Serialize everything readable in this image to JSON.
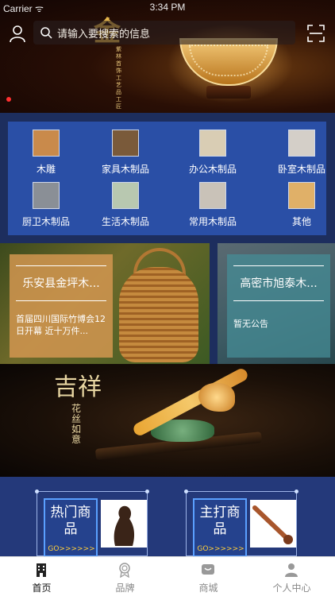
{
  "status": {
    "carrier": "Carrier ᯤ",
    "time": "3:34 PM"
  },
  "search": {
    "placeholder": "请输入要搜索的信息"
  },
  "banner": {
    "calligraphy": "金",
    "vertical": "紫林首饰工艺品工匠"
  },
  "categories": [
    {
      "label": "木雕",
      "thumb": "#c98a4b"
    },
    {
      "label": "家具木制品",
      "thumb": "#7a5a3a"
    },
    {
      "label": "办公木制品",
      "thumb": "#d9cdb4"
    },
    {
      "label": "卧室木制品",
      "thumb": "#d4cfc8"
    },
    {
      "label": "厨卫木制品",
      "thumb": "#8a8f96"
    },
    {
      "label": "生活木制品",
      "thumb": "#b8c8b0"
    },
    {
      "label": "常用木制品",
      "thumb": "#c9c2b8"
    },
    {
      "label": "其他",
      "thumb": "#e0b068"
    }
  ],
  "promos": {
    "left": {
      "title": "乐安县金坪木...",
      "desc": "首届四川国际竹博会12日开幕 近十万件..."
    },
    "right": {
      "title": "高密市旭泰木...",
      "desc": "暂无公告"
    }
  },
  "banner2": {
    "calligraphy": "吉祥",
    "sub": "花丝如意"
  },
  "featured": [
    {
      "title": "热门商品",
      "go": "GO>>>>>>"
    },
    {
      "title": "主打商品",
      "go": "GO>>>>>>"
    }
  ],
  "tabs": [
    {
      "label": "首页",
      "icon": "home-building-icon",
      "active": true
    },
    {
      "label": "品牌",
      "icon": "medal-icon",
      "active": false
    },
    {
      "label": "商城",
      "icon": "store-icon",
      "active": false
    },
    {
      "label": "个人中心",
      "icon": "user-center-icon",
      "active": false
    }
  ],
  "colors": {
    "accent": "#2a4fa6",
    "panel": "#1d2e5e",
    "go": "#ffcf3a"
  }
}
